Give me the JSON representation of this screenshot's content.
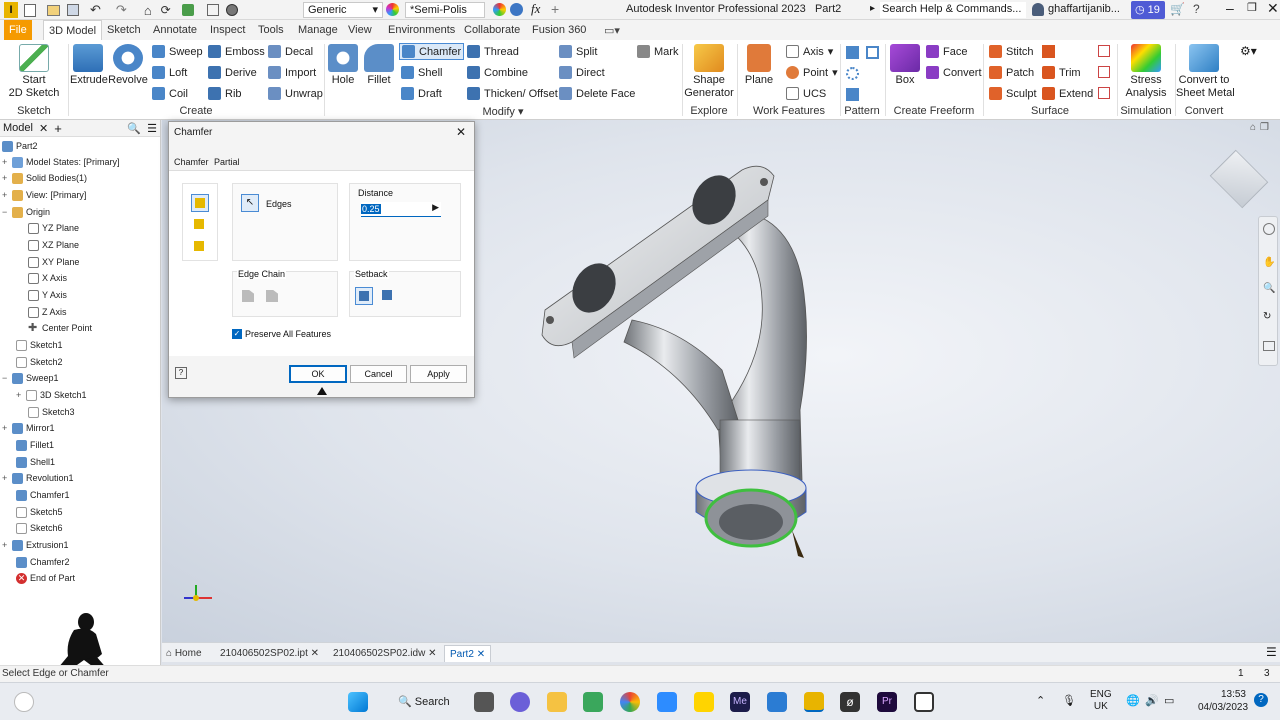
{
  "titlebar": {
    "app_title": "Autodesk Inventor Professional 2023",
    "doc_name": "Part2",
    "appearance": "Generic",
    "material": "*Semi-Polis",
    "search_placeholder": "Search Help & Commands...",
    "user": "ghaffartijanib...",
    "notifications": "19",
    "fx_label": "fx"
  },
  "ribbon_tabs": [
    "File",
    "3D Model",
    "Sketch",
    "Annotate",
    "Inspect",
    "Tools",
    "Manage",
    "View",
    "Environments",
    "Collaborate",
    "Fusion 360"
  ],
  "ribbon": {
    "sketch": {
      "start_2d_sketch": "Start\n2D Sketch",
      "group": "Sketch"
    },
    "create": {
      "extrude": "Extrude",
      "revolve": "Revolve",
      "sweep": "Sweep",
      "loft": "Loft",
      "coil": "Coil",
      "emboss": "Emboss",
      "derive": "Derive",
      "rib": "Rib",
      "decal": "Decal",
      "import": "Import",
      "unwrap": "Unwrap",
      "group": "Create"
    },
    "modify": {
      "hole": "Hole",
      "fillet": "Fillet",
      "chamfer": "Chamfer",
      "shell": "Shell",
      "draft": "Draft",
      "thread": "Thread",
      "combine": "Combine",
      "thicken": "Thicken/ Offset",
      "split": "Split",
      "direct": "Direct",
      "delete_face": "Delete Face",
      "mark": "Mark",
      "group": "Modify"
    },
    "explore": {
      "shape_generator": "Shape\nGenerator",
      "group": "Explore"
    },
    "work_features": {
      "plane": "Plane",
      "axis": "Axis",
      "point": "Point",
      "ucs": "UCS",
      "group": "Work Features"
    },
    "pattern": {
      "group": "Pattern"
    },
    "freeform": {
      "box": "Box",
      "face": "Face",
      "convert": "Convert",
      "group": "Create Freeform"
    },
    "surface": {
      "stitch": "Stitch",
      "patch": "Patch",
      "sculpt": "Sculpt",
      "trim": "Trim",
      "extend": "Extend",
      "group": "Surface"
    },
    "simulation": {
      "stress": "Stress\nAnalysis",
      "group": "Simulation"
    },
    "convert": {
      "sheet_metal": "Convert to\nSheet Metal",
      "group": "Convert"
    }
  },
  "browser": {
    "tab": "Model",
    "nodes": [
      {
        "label": "Part2"
      },
      {
        "label": "Model States: [Primary]"
      },
      {
        "label": "Solid Bodies(1)"
      },
      {
        "label": "View: [Primary]"
      },
      {
        "label": "Origin"
      },
      {
        "label": "YZ Plane"
      },
      {
        "label": "XZ Plane"
      },
      {
        "label": "XY Plane"
      },
      {
        "label": "X Axis"
      },
      {
        "label": "Y Axis"
      },
      {
        "label": "Z Axis"
      },
      {
        "label": "Center Point"
      },
      {
        "label": "Sketch1"
      },
      {
        "label": "Sketch2"
      },
      {
        "label": "Sweep1"
      },
      {
        "label": "3D Sketch1"
      },
      {
        "label": "Sketch3"
      },
      {
        "label": "Mirror1"
      },
      {
        "label": "Fillet1"
      },
      {
        "label": "Shell1"
      },
      {
        "label": "Revolution1"
      },
      {
        "label": "Chamfer1"
      },
      {
        "label": "Sketch5"
      },
      {
        "label": "Sketch6"
      },
      {
        "label": "Extrusion1"
      },
      {
        "label": "Chamfer2"
      },
      {
        "label": "End of Part"
      }
    ]
  },
  "dialog": {
    "title": "Chamfer",
    "tabs": [
      "Chamfer",
      "Partial"
    ],
    "edges_label": "Edges",
    "distance_label": "Distance",
    "distance_value": "0.25",
    "edge_chain_label": "Edge Chain",
    "setback_label": "Setback",
    "preserve_label": "Preserve All Features",
    "ok": "OK",
    "cancel": "Cancel",
    "apply": "Apply"
  },
  "doc_tabs": {
    "home": "Home",
    "tabs": [
      "210406502SP02.ipt",
      "210406502SP02.idw",
      "Part2"
    ]
  },
  "status": {
    "text": "Select Edge or Chamfer",
    "n1": "1",
    "n2": "3"
  },
  "taskbar": {
    "search": "Search",
    "lang": "ENG",
    "region": "UK",
    "time": "13:53",
    "date": "04/03/2023"
  },
  "colors": {
    "file_tab": "#f59a00",
    "accent": "#0067c0",
    "selection": "#3fbf3f"
  }
}
